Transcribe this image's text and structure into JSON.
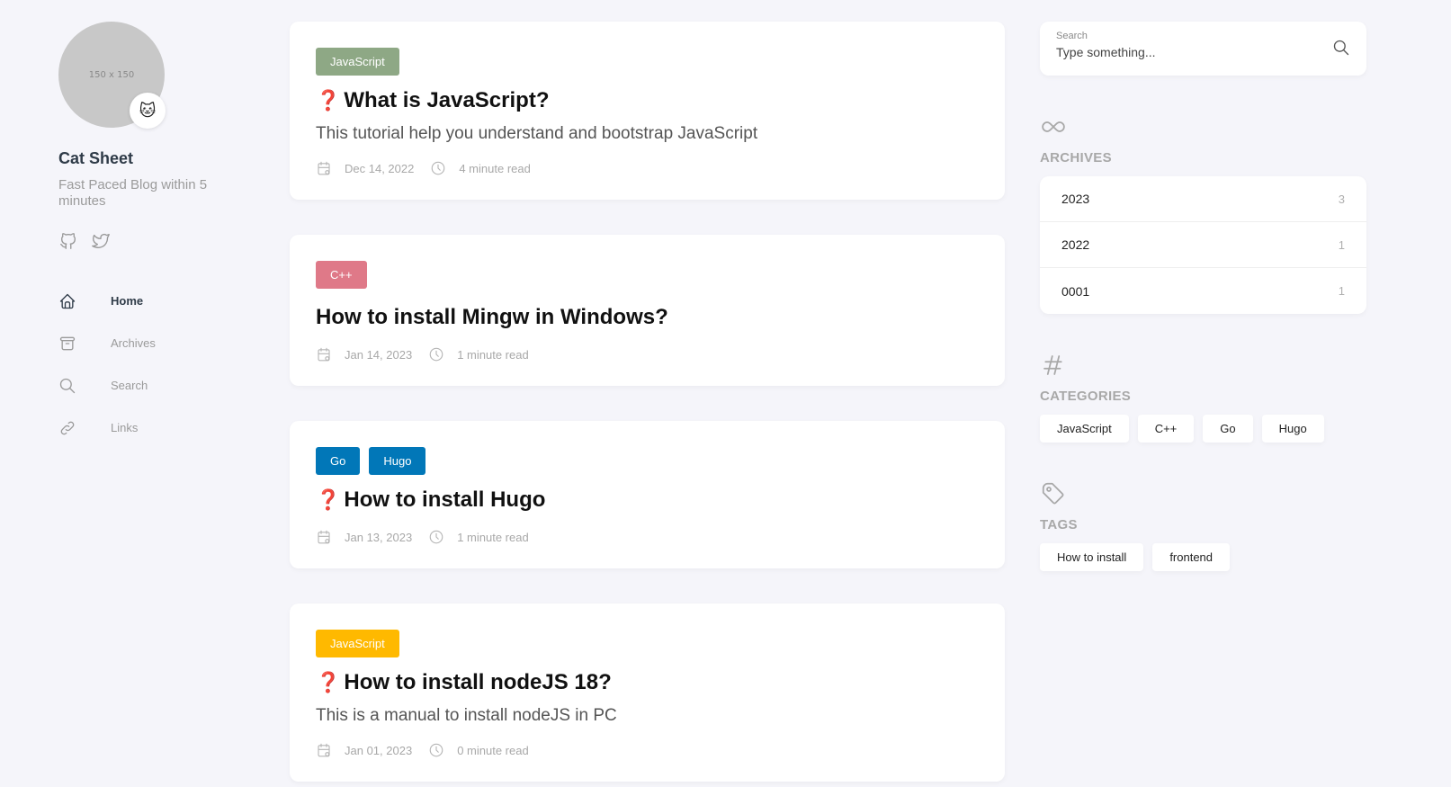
{
  "sidebar": {
    "avatar_placeholder": "150 x 150",
    "avatar_emoji": "🐱",
    "site_name": "Cat Sheet",
    "site_description": "Fast Paced Blog within 5 minutes",
    "social": [
      {
        "icon": "github-icon"
      },
      {
        "icon": "twitter-icon"
      }
    ],
    "menu": [
      {
        "label": "Home",
        "icon": "home-icon",
        "active": true
      },
      {
        "label": "Archives",
        "icon": "archive-icon",
        "active": false
      },
      {
        "label": "Search",
        "icon": "search-icon",
        "active": false
      },
      {
        "label": "Links",
        "icon": "link-icon",
        "active": false
      }
    ]
  },
  "posts": [
    {
      "categories": [
        {
          "label": "JavaScript",
          "color": "#8ea885"
        }
      ],
      "title_prefix": "❓",
      "title": "What is JavaScript?",
      "excerpt": "This tutorial help you understand and bootstrap JavaScript",
      "date": "Dec 14, 2022",
      "read_time": "4 minute read"
    },
    {
      "categories": [
        {
          "label": "C++",
          "color": "#df7988"
        }
      ],
      "title_prefix": "",
      "title": "How to install Mingw in Windows?",
      "excerpt": "",
      "date": "Jan 14, 2023",
      "read_time": "1 minute read"
    },
    {
      "categories": [
        {
          "label": "Go",
          "color": "#0177b8"
        },
        {
          "label": "Hugo",
          "color": "#0177b8"
        }
      ],
      "title_prefix": "❓",
      "title": "How to install Hugo",
      "excerpt": "",
      "date": "Jan 13, 2023",
      "read_time": "1 minute read"
    },
    {
      "categories": [
        {
          "label": "JavaScript",
          "color": "#ffb900"
        }
      ],
      "title_prefix": "❓",
      "title": "How to install nodeJS 18?",
      "excerpt": "This is a manual to install nodeJS in PC",
      "date": "Jan 01, 2023",
      "read_time": "0 minute read"
    }
  ],
  "search": {
    "label": "Search",
    "placeholder": "Type something..."
  },
  "archives": {
    "title": "ARCHIVES",
    "items": [
      {
        "year": "2023",
        "count": "3"
      },
      {
        "year": "2022",
        "count": "1"
      },
      {
        "year": "0001",
        "count": "1"
      }
    ]
  },
  "categories": {
    "title": "CATEGORIES",
    "items": [
      "JavaScript",
      "C++",
      "Go",
      "Hugo"
    ]
  },
  "tags": {
    "title": "TAGS",
    "items": [
      "How to install",
      "frontend"
    ]
  }
}
